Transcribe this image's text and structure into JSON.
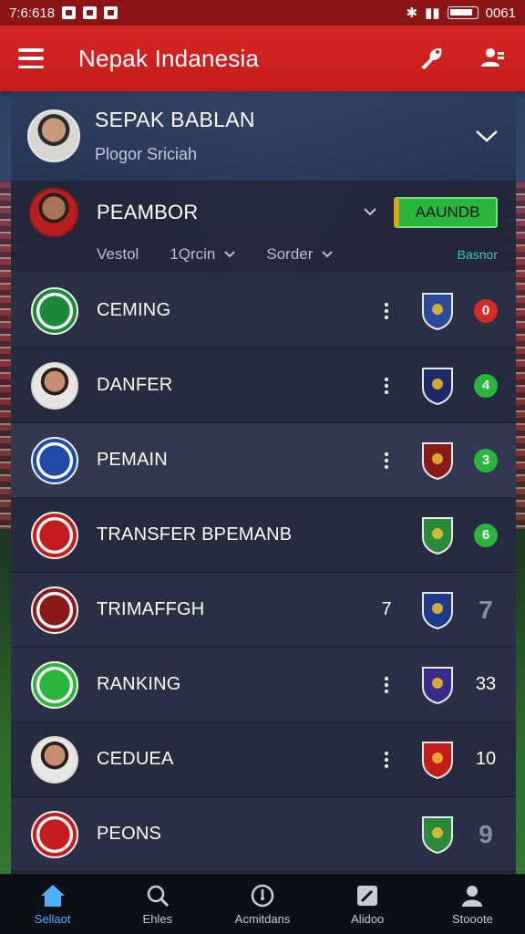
{
  "status_bar": {
    "time": "7:6:618",
    "right_text": "0061"
  },
  "app_bar": {
    "title": "Nepak Indanesia",
    "menu_icon": "menu-icon",
    "action_icons": [
      "shuttlecock-icon",
      "users-icon"
    ]
  },
  "header": {
    "title": "SEPAK BABLAN",
    "subtitle": "Plogor Sriciah"
  },
  "panel": {
    "title": "PEAMBOR",
    "button_label": "AAUNDB",
    "filters": [
      {
        "label": "Vestol"
      },
      {
        "label": "1Qrcin"
      },
      {
        "label": "Sorder"
      }
    ],
    "link_label": "Basnor"
  },
  "rows": [
    {
      "name": "CEMING",
      "left_value": "",
      "score": "0",
      "score_style": "badge",
      "score_color": "#d42a2a",
      "crest_color": "#1a8a3a",
      "opp_color": "#2a4a9a"
    },
    {
      "name": "DANFER",
      "left_value": "",
      "score": "4",
      "score_style": "badge",
      "score_color": "#2ab53c",
      "crest_color": "avatar",
      "opp_color": "#1d2a6a"
    },
    {
      "name": "PEMAIN",
      "left_value": "",
      "score": "3",
      "score_style": "badge",
      "score_color": "#2ab53c",
      "crest_color": "#1f4aa8",
      "opp_color": "#8a1a1a"
    },
    {
      "name": "TRANSFER BPEMANB",
      "left_value": "",
      "score": "6",
      "score_style": "badge",
      "score_color": "#2ab53c",
      "crest_color": "#c41c1c",
      "opp_color": "#2a8a3a"
    },
    {
      "name": "TRIMAFFGH",
      "left_value": "7",
      "score": "7",
      "score_style": "big",
      "score_color": "#8a8e9a",
      "crest_color": "#8a1a1a",
      "opp_color": "#1d3a8a"
    },
    {
      "name": "RANKING",
      "left_value": "",
      "score": "33",
      "score_style": "plain",
      "score_color": "#ffffff",
      "crest_color": "#2ab53c",
      "opp_color": "#3a2a8a"
    },
    {
      "name": "CEDUEA",
      "left_value": "",
      "score": "10",
      "score_style": "plain",
      "score_color": "#ffffff",
      "crest_color": "avatar",
      "opp_color": "#c41c1c"
    },
    {
      "name": "PEONS",
      "left_value": "",
      "score": "9",
      "score_style": "big",
      "score_color": "#8a8e9a",
      "crest_color": "#c41c1c",
      "opp_color": "#2a8a3a"
    }
  ],
  "bottom_nav": [
    {
      "label": "Sellaot",
      "icon": "home-icon",
      "active": true
    },
    {
      "label": "Ehles",
      "icon": "search-icon",
      "active": false
    },
    {
      "label": "Acmitdans",
      "icon": "clock-icon",
      "active": false
    },
    {
      "label": "Alidoo",
      "icon": "edit-icon",
      "active": false
    },
    {
      "label": "Stooote",
      "icon": "person-icon",
      "active": false
    }
  ]
}
